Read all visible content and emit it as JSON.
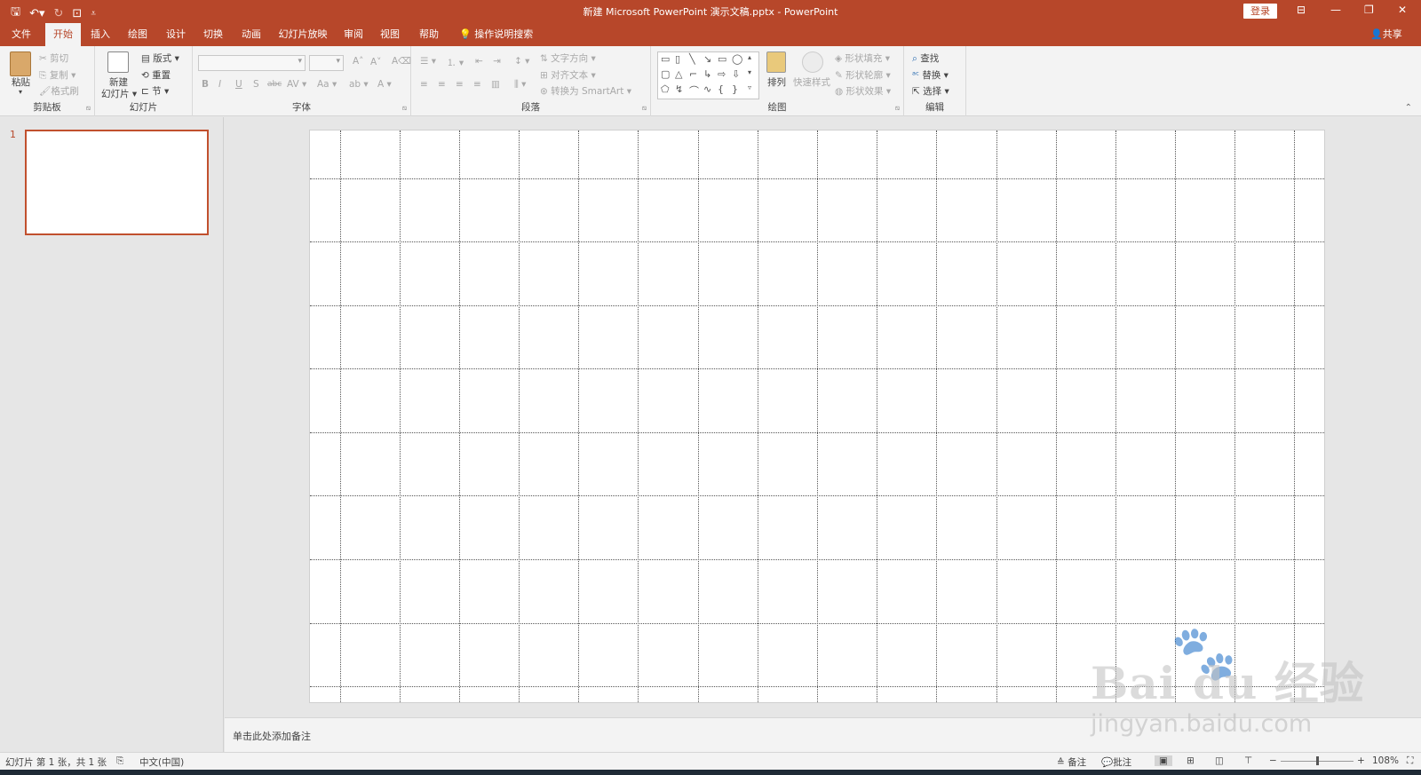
{
  "window": {
    "title": "新建 Microsoft PowerPoint 演示文稿.pptx  -  PowerPoint",
    "login_label": "登录",
    "qat": [
      "save-icon",
      "undo-icon",
      "redo-icon",
      "slideshow-from-start-icon",
      "customize-qat-icon"
    ],
    "controls": [
      "ribbon-display-options-icon",
      "minimize-icon",
      "restore-icon",
      "close-icon"
    ]
  },
  "menu": {
    "tabs": [
      "文件",
      "开始",
      "插入",
      "绘图",
      "设计",
      "切换",
      "动画",
      "幻灯片放映",
      "审阅",
      "视图",
      "帮助"
    ],
    "active_tab": "开始",
    "tell_me": "操作说明搜索",
    "share": "共享"
  },
  "ribbon": {
    "clipboard": {
      "label": "剪贴板",
      "paste": "粘贴",
      "cut": "剪切",
      "copy": "复制",
      "format_painter": "格式刷"
    },
    "slides": {
      "label": "幻灯片",
      "new_slide_line1": "新建",
      "new_slide_line2": "幻灯片",
      "layout": "版式",
      "reset": "重置",
      "section": "节"
    },
    "font": {
      "label": "字体",
      "font_name": "",
      "font_size": ""
    },
    "paragraph": {
      "label": "段落",
      "text_direction": "文字方向",
      "align_text": "对齐文本",
      "convert_smartart": "转换为 SmartArt"
    },
    "drawing": {
      "label": "绘图",
      "arrange": "排列",
      "quick_styles": "快速样式",
      "shape_fill": "形状填充",
      "shape_outline": "形状轮廓",
      "shape_effects": "形状效果"
    },
    "editing": {
      "label": "编辑",
      "find": "查找",
      "replace": "替换",
      "select": "选择"
    }
  },
  "thumbnails": [
    {
      "number": "1"
    }
  ],
  "notes_placeholder": "单击此处添加备注",
  "statusbar": {
    "slide_info": "幻灯片 第 1 张，共 1 张",
    "language": "中文(中国)",
    "notes": "备注",
    "comments": "批注",
    "zoom": "108%"
  },
  "watermark": {
    "brand": "Bai du 经验",
    "url": "jingyan.baidu.com"
  },
  "colors": {
    "accent": "#b7472a",
    "ribbon_bg": "#f3f3f3",
    "workspace": "#e6e6e6"
  }
}
